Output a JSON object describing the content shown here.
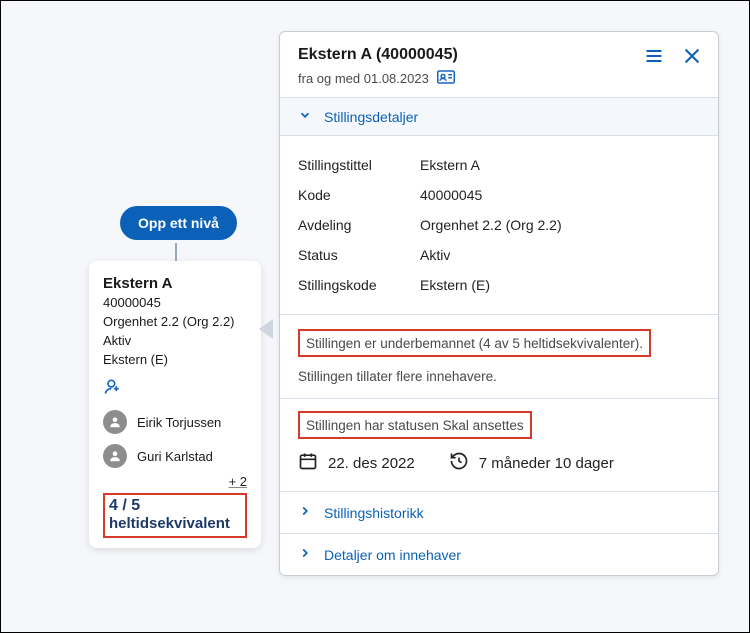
{
  "upLevel": {
    "label": "Opp ett nivå"
  },
  "node": {
    "title": "Ekstern A",
    "code": "40000045",
    "dept": "Orgenhet 2.2 (Org 2.2)",
    "status": "Aktiv",
    "jobCode": "Ekstern (E)",
    "people": [
      {
        "name": "Eirik Torjussen"
      },
      {
        "name": "Guri Karlstad"
      }
    ],
    "more": "+ 2",
    "fte": {
      "ratio": "4 / 5",
      "label": "heltidsekvivalent"
    }
  },
  "panel": {
    "title": "Ekstern A (40000045)",
    "subtitle": "fra og med 01.08.2023",
    "sections": {
      "details": {
        "header": "Stillingsdetaljer",
        "rows": {
          "jobTitleKey": "Stillingstittel",
          "jobTitleVal": "Ekstern A",
          "codeKey": "Kode",
          "codeVal": "40000045",
          "deptKey": "Avdeling",
          "deptVal": "Orgenhet 2.2 (Org 2.2)",
          "statusKey": "Status",
          "statusVal": "Aktiv",
          "jobCodeKey": "Stillingskode",
          "jobCodeVal": "Ekstern (E)"
        }
      },
      "info": {
        "understaffed": "Stillingen er underbemannet (4 av 5 heltidsekvivalenter).",
        "allowsMultiple": "Stillingen tillater flere innehavere."
      },
      "statusSection": {
        "header": "Stillingen har statusen Skal ansettes",
        "date": "22. des 2022",
        "duration": "7 måneder 10 dager"
      },
      "history": "Stillingshistorikk",
      "holderDetails": "Detaljer om innehaver"
    }
  }
}
